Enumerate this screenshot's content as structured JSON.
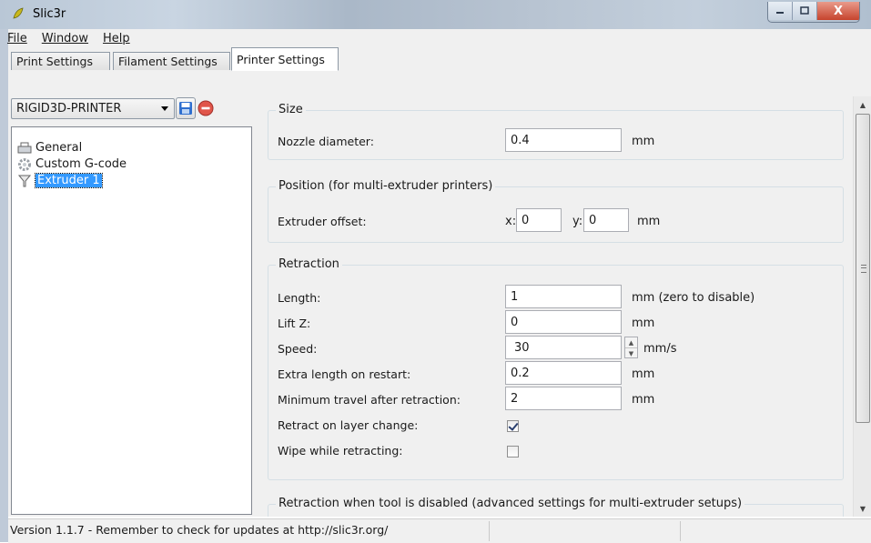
{
  "window": {
    "title": "Slic3r",
    "buttons": {
      "minimize": "—",
      "maximize": "□",
      "close": "X"
    }
  },
  "menu": {
    "items": [
      "File",
      "Window",
      "Help"
    ]
  },
  "tabs": [
    {
      "label": "Print Settings",
      "active": false
    },
    {
      "label": "Filament Settings",
      "active": false
    },
    {
      "label": "Printer Settings",
      "active": true
    }
  ],
  "preset": {
    "selected": "RIGID3D-PRINTER",
    "save_icon": "save-icon",
    "delete_icon": "delete-icon"
  },
  "tree": {
    "items": [
      {
        "label": "General",
        "icon": "printer-icon",
        "selected": false
      },
      {
        "label": "Custom G-code",
        "icon": "cog-icon",
        "selected": false
      },
      {
        "label": "Extruder 1",
        "icon": "funnel-icon",
        "selected": true
      }
    ]
  },
  "size_group": {
    "title": "Size",
    "nozzle_label": "Nozzle diameter:",
    "nozzle_value": "0.4",
    "nozzle_unit": "mm"
  },
  "position_group": {
    "title": "Position (for multi-extruder printers)",
    "offset_label": "Extruder offset:",
    "x_label": "x:",
    "x_value": "0",
    "y_label": "y:",
    "y_value": "0",
    "unit": "mm"
  },
  "retraction_group": {
    "title": "Retraction",
    "length_label": "Length:",
    "length_value": "1",
    "length_unit": "mm (zero to disable)",
    "liftz_label": "Lift Z:",
    "liftz_value": "0",
    "liftz_unit": "mm",
    "speed_label": "Speed:",
    "speed_value": "30",
    "speed_unit": "mm/s",
    "extra_label": "Extra length on restart:",
    "extra_value": "0.2",
    "extra_unit": "mm",
    "mintravel_label": "Minimum travel after retraction:",
    "mintravel_value": "2",
    "mintravel_unit": "mm",
    "layerchange_label": "Retract on layer change:",
    "layerchange_checked": true,
    "wipe_label": "Wipe while retracting:",
    "wipe_checked": false
  },
  "disabled_group": {
    "title": "Retraction when tool is disabled (advanced settings for multi-extruder setups)"
  },
  "status": {
    "text": "Version 1.1.7 - Remember to check for updates at http://slic3r.org/"
  }
}
